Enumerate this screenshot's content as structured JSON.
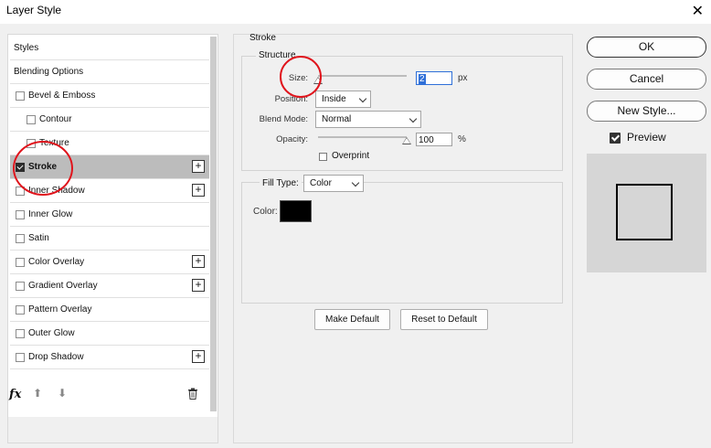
{
  "window": {
    "title": "Layer Style",
    "close_glyph": "✕"
  },
  "left_panel": {
    "items": [
      {
        "label": "Styles",
        "has_checkbox": false,
        "checked": false,
        "has_plus": false,
        "indent": 0,
        "selected": false
      },
      {
        "label": "Blending Options",
        "has_checkbox": false,
        "checked": false,
        "has_plus": false,
        "indent": 0,
        "selected": false
      },
      {
        "label": "Bevel & Emboss",
        "has_checkbox": true,
        "checked": false,
        "has_plus": false,
        "indent": 0,
        "selected": false
      },
      {
        "label": "Contour",
        "has_checkbox": true,
        "checked": false,
        "has_plus": false,
        "indent": 1,
        "selected": false
      },
      {
        "label": "Texture",
        "has_checkbox": true,
        "checked": false,
        "has_plus": false,
        "indent": 1,
        "selected": false
      },
      {
        "label": "Stroke",
        "has_checkbox": true,
        "checked": true,
        "has_plus": true,
        "indent": 0,
        "selected": true
      },
      {
        "label": "Inner Shadow",
        "has_checkbox": true,
        "checked": false,
        "has_plus": true,
        "indent": 0,
        "selected": false
      },
      {
        "label": "Inner Glow",
        "has_checkbox": true,
        "checked": false,
        "has_plus": false,
        "indent": 0,
        "selected": false
      },
      {
        "label": "Satin",
        "has_checkbox": true,
        "checked": false,
        "has_plus": false,
        "indent": 0,
        "selected": false
      },
      {
        "label": "Color Overlay",
        "has_checkbox": true,
        "checked": false,
        "has_plus": true,
        "indent": 0,
        "selected": false
      },
      {
        "label": "Gradient Overlay",
        "has_checkbox": true,
        "checked": false,
        "has_plus": true,
        "indent": 0,
        "selected": false
      },
      {
        "label": "Pattern Overlay",
        "has_checkbox": true,
        "checked": false,
        "has_plus": false,
        "indent": 0,
        "selected": false
      },
      {
        "label": "Outer Glow",
        "has_checkbox": true,
        "checked": false,
        "has_plus": false,
        "indent": 0,
        "selected": false
      },
      {
        "label": "Drop Shadow",
        "has_checkbox": true,
        "checked": false,
        "has_plus": true,
        "indent": 0,
        "selected": false
      }
    ],
    "plus_glyph": "+",
    "bottom": {
      "fx_label": "fx",
      "move_up_glyph": "⬆",
      "move_down_glyph": "⬇",
      "trash_icon": "trash-icon"
    }
  },
  "stroke": {
    "section_title": "Stroke",
    "structure_title": "Structure",
    "size_label": "Size:",
    "size_value": "2",
    "size_unit": "px",
    "size_slider_level": 0.0,
    "position_label": "Position:",
    "position_value": "Inside",
    "blend_mode_label": "Blend Mode:",
    "blend_mode_value": "Normal",
    "opacity_label": "Opacity:",
    "opacity_value": "100",
    "opacity_unit": "%",
    "opacity_slider_level": 1.0,
    "overprint_label": "Overprint",
    "overprint_checked": false,
    "fill_type_label": "Fill Type:",
    "fill_type_value": "Color",
    "color_label": "Color:",
    "color_value": "#000000",
    "make_default_label": "Make Default",
    "reset_default_label": "Reset to Default"
  },
  "actions": {
    "ok_label": "OK",
    "cancel_label": "Cancel",
    "new_style_label": "New Style...",
    "preview_label": "Preview",
    "preview_checked": true
  },
  "colors": {
    "annotation_red": "#e0141c",
    "selected_row": "#bcbcbc",
    "focus_blue": "#2e6fd8"
  }
}
